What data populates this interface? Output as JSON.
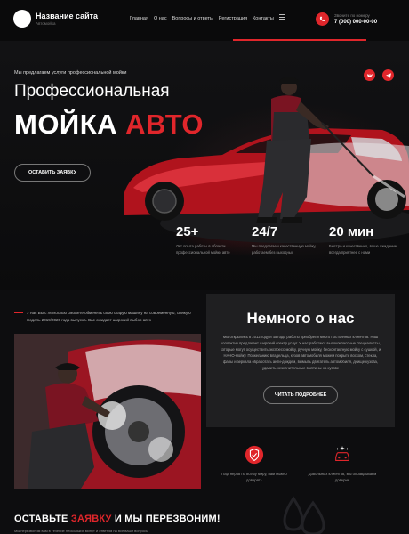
{
  "header": {
    "site_name": "Название сайта",
    "site_sub": "Автомойка",
    "nav": [
      "Главная",
      "О нас",
      "Вопросы и ответы",
      "Регистрация",
      "Контакты"
    ],
    "phone_label": "Звоните по номеру",
    "phone": "7 (000) 000-00-00"
  },
  "hero": {
    "kicker": "Мы предлагаем услуги профессиональной мойки",
    "title_pre": "Про",
    "title_hl": "фессио",
    "title_post": "нальная",
    "title2_white": "МОЙКА ",
    "title2_red": "АВТО",
    "cta": "ОСТАВИТЬ ЗАЯВКУ",
    "social": [
      "vk-icon",
      "telegram-icon"
    ],
    "stats": [
      {
        "num": "25+",
        "txt": "Лет опыта работы в области профессиональной мойки авто"
      },
      {
        "num": "24/7",
        "txt": "Мы предлагаем качественную мойку, работаем без выходных"
      },
      {
        "num": "20 мин",
        "txt": "Быстро и качественно, вашe ожидание всегда приятнее с нами"
      }
    ]
  },
  "intro": "У нас Вы с легкостью сможете обменять свою старую машину на современную, свежую модель 2019/2020 года выпуска. Вас ожидает широкий выбор авто",
  "about": {
    "title": "Немного о нас",
    "text": "Мы открылись в 2012 году и за годы работы приобрели много постоянных клиентов. Наш коллектив предлагает широкий спектр услуг. У нас работают высококлассные специалисты, которые могут осуществить экспресс-мойку, ручную мойку, бесконтактную мойку с сушкой, и НАНО-мойку. По желанию владельца, кузов автомобиля можем покрыть воском, стекла, фары и зеркала обработать анти-дождем, вымыть двигатель автомобиля, днище кузова, удалить незначительные вмятины на кузове",
    "cta": "ЧИТАТЬ ПОДРОБНЕЕ"
  },
  "features": [
    {
      "icon": "shield-check-icon",
      "txt": "Партнеров по всему миру, нам можно доверять"
    },
    {
      "icon": "car-sparkle-icon",
      "txt": "Довольных клиентов, мы оправдываем доверие"
    }
  ],
  "callback": {
    "title_white1": "ОСТАВЬТЕ ",
    "title_red": "ЗАЯВКУ",
    "title_white2": " И МЫ ПЕРЕЗВОНИМ!",
    "sub": "Мы перезвоним вам в течение нескольких минут и ответим на все ваши вопросы"
  },
  "colors": {
    "accent": "#e0262b",
    "bg": "#0d0d0f",
    "panel": "#1f1f21"
  }
}
